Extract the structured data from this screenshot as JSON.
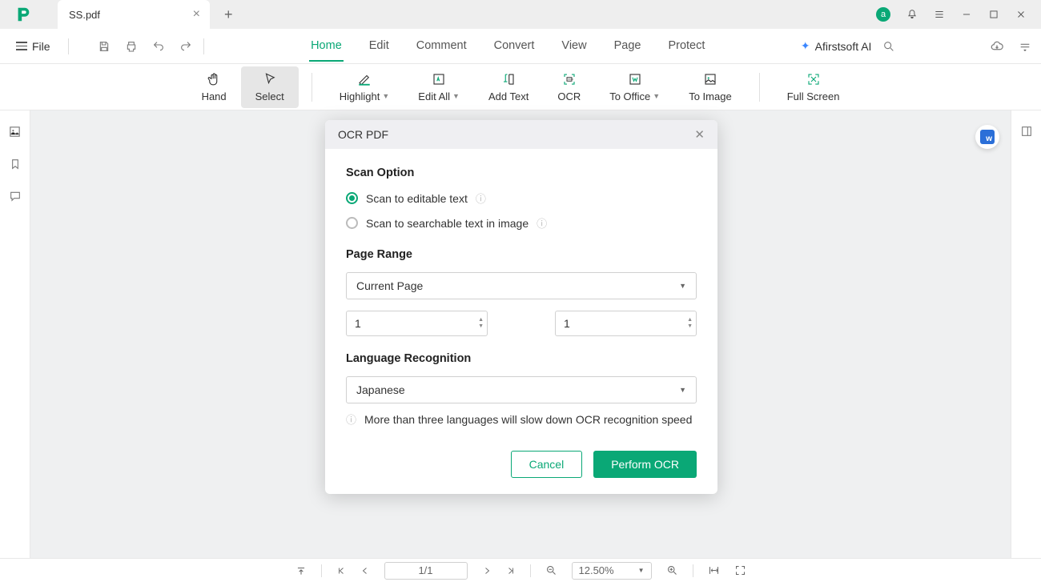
{
  "app": {
    "tab_title": "SS.pdf",
    "avatar_letter": "a"
  },
  "menu": {
    "file": "File",
    "tabs": [
      "Home",
      "Edit",
      "Comment",
      "Convert",
      "View",
      "Page",
      "Protect"
    ],
    "active_tab_index": 0,
    "ai_label": "Afirstsoft AI"
  },
  "toolbar": {
    "items": [
      {
        "label": "Hand",
        "icon": "hand",
        "active": false,
        "caret": false
      },
      {
        "label": "Select",
        "icon": "cursor",
        "active": true,
        "caret": false
      },
      {
        "divider": true
      },
      {
        "label": "Highlight",
        "icon": "highlight",
        "active": false,
        "caret": true
      },
      {
        "label": "Edit All",
        "icon": "editall",
        "active": false,
        "caret": true
      },
      {
        "label": "Add Text",
        "icon": "addtext",
        "active": false,
        "caret": false
      },
      {
        "label": "OCR",
        "icon": "ocr",
        "active": false,
        "caret": false
      },
      {
        "label": "To Office",
        "icon": "tooffice",
        "active": false,
        "caret": true
      },
      {
        "label": "To Image",
        "icon": "toimage",
        "active": false,
        "caret": false
      },
      {
        "divider": true
      },
      {
        "label": "Full Screen",
        "icon": "fullscreen",
        "active": false,
        "caret": false
      }
    ]
  },
  "dialog": {
    "title": "OCR PDF",
    "scan_option_title": "Scan Option",
    "option_editable": "Scan to editable text",
    "option_searchable": "Scan to searchable text in image",
    "selected_option": "editable",
    "page_range_title": "Page Range",
    "page_range_value": "Current Page",
    "page_from": "1",
    "page_to": "1",
    "language_title": "Language Recognition",
    "language_value": "Japanese",
    "hint": "More than three languages will slow down OCR recognition speed",
    "cancel": "Cancel",
    "perform": "Perform OCR"
  },
  "statusbar": {
    "page": "1/1",
    "zoom": "12.50%"
  }
}
